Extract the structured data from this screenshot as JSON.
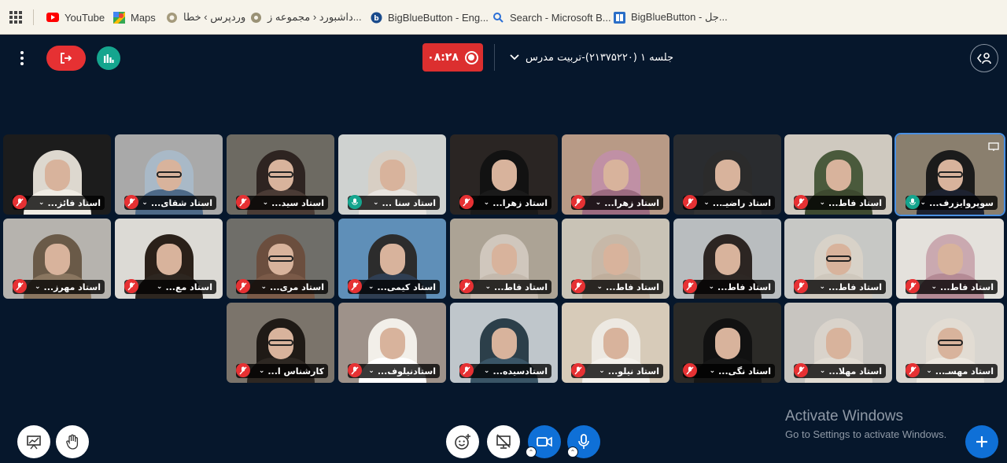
{
  "bookmarks": [
    {
      "label": "YouTube",
      "icon": "youtube-icon"
    },
    {
      "label": "Maps",
      "icon": "maps-icon"
    },
    {
      "label": "وردپرس › خطا",
      "icon": "wordpress-icon"
    },
    {
      "label": "داشبورد ‹ مجموعه ز...",
      "icon": "site-icon"
    },
    {
      "label": "BigBlueButton - Eng...",
      "icon": "bigbluebutton-icon"
    },
    {
      "label": "Search - Microsoft B...",
      "icon": "search-icon"
    },
    {
      "label": "BigBlueButton - جل...",
      "icon": "bigbluebutton-icon"
    }
  ],
  "header": {
    "record_time": "۰۸:۲۸",
    "meeting_title": "جلسه ۱ (۲۱۳۷۵۲۲۰)-تربیت مدرس"
  },
  "participants": [
    {
      "name": "سوپروایزرف...",
      "mic": "live",
      "presenter": true
    },
    {
      "name": "استاد فاط...",
      "mic": "muted"
    },
    {
      "name": "استاد راضیـ...",
      "mic": "muted"
    },
    {
      "name": "استاد زهرا...",
      "mic": "muted"
    },
    {
      "name": "استاد زهرا...",
      "mic": "muted"
    },
    {
      "name": "استاد سنا ...",
      "mic": "live"
    },
    {
      "name": "استاد سید...",
      "mic": "muted"
    },
    {
      "name": "استاد شقای...",
      "mic": "muted"
    },
    {
      "name": "استاد فائز...",
      "mic": "muted"
    },
    {
      "name": "استاد فاط...",
      "mic": "muted"
    },
    {
      "name": "استاد فاط...",
      "mic": "muted"
    },
    {
      "name": "استاد فاط...",
      "mic": "muted"
    },
    {
      "name": "استاد فاط...",
      "mic": "muted"
    },
    {
      "name": "استاد فاط...",
      "mic": "muted"
    },
    {
      "name": "استاد کیمی...",
      "mic": "muted"
    },
    {
      "name": "استاد مری...",
      "mic": "muted"
    },
    {
      "name": "استاد مع...",
      "mic": "muted"
    },
    {
      "name": "استاد مهرز...",
      "mic": "muted"
    },
    {
      "name": "استاد مهسـ...",
      "mic": "muted"
    },
    {
      "name": "استاد مهلا...",
      "mic": "muted"
    },
    {
      "name": "استاد نگی...",
      "mic": "muted"
    },
    {
      "name": "استاد نیلو...",
      "mic": "muted"
    },
    {
      "name": "استادسیده...",
      "mic": "muted"
    },
    {
      "name": "استادنیلوف...",
      "mic": "muted"
    },
    {
      "name": "کارشناس ا...",
      "mic": "muted"
    }
  ],
  "watermark": {
    "line1": "Activate Windows",
    "line2": "Go to Settings to activate Windows."
  },
  "colors": {
    "background": "#06172c",
    "leave": "#e63133",
    "record": "#dc2f2f",
    "accent_blue": "#0f70d7",
    "mic_live": "#15a58e"
  }
}
